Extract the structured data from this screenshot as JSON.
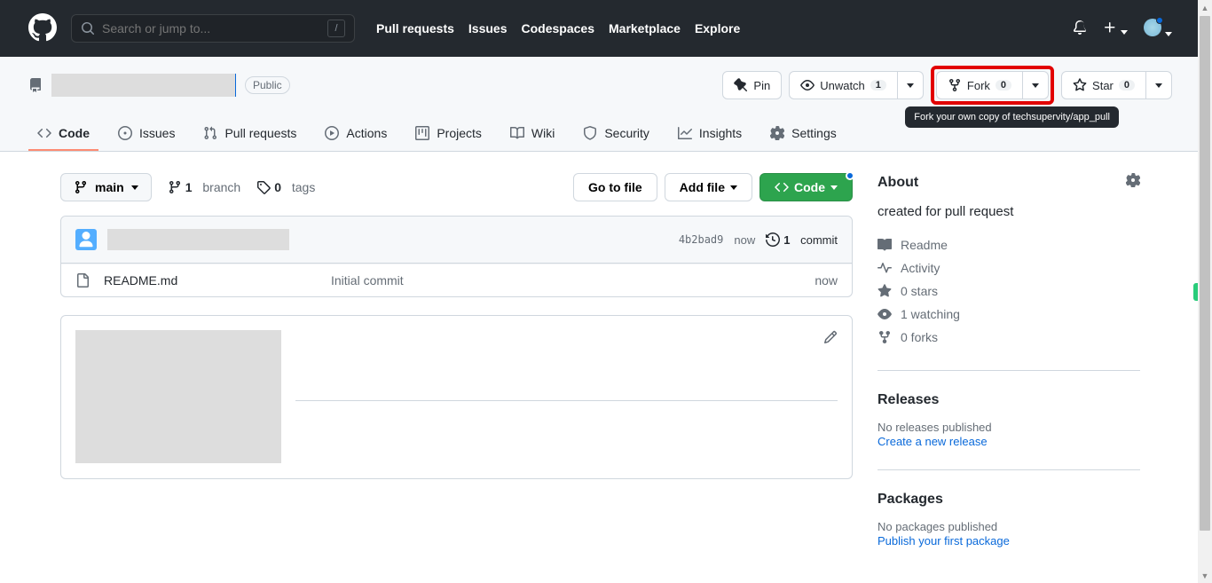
{
  "header": {
    "search_placeholder": "Search or jump to...",
    "slash": "/",
    "nav": [
      "Pull requests",
      "Issues",
      "Codespaces",
      "Marketplace",
      "Explore"
    ]
  },
  "repo": {
    "visibility": "Public",
    "actions": {
      "pin": "Pin",
      "watch": "Unwatch",
      "watch_count": "1",
      "fork": "Fork",
      "fork_count": "0",
      "star": "Star",
      "star_count": "0"
    },
    "tooltip": "Fork your own copy of techsupervity/app_pull",
    "tabs": [
      "Code",
      "Issues",
      "Pull requests",
      "Actions",
      "Projects",
      "Wiki",
      "Security",
      "Insights",
      "Settings"
    ]
  },
  "files": {
    "branch": "main",
    "branch_count": "1",
    "branch_label": "branch",
    "tag_count": "0",
    "tag_label": "tags",
    "goto": "Go to file",
    "addfile": "Add file",
    "codebtn": "Code",
    "commit_hash": "4b2bad9",
    "commit_time": "now",
    "commit_count": "1",
    "commit_label": "commit",
    "rows": [
      {
        "name": "README.md",
        "msg": "Initial commit",
        "date": "now"
      }
    ]
  },
  "sidebar": {
    "about_title": "About",
    "about_desc": "created for pull request",
    "links": {
      "readme": "Readme",
      "activity": "Activity",
      "stars": "0 stars",
      "watching": "1 watching",
      "forks": "0 forks"
    },
    "releases_title": "Releases",
    "releases_none": "No releases published",
    "releases_create": "Create a new release",
    "packages_title": "Packages",
    "packages_none": "No packages published",
    "packages_publish": "Publish your first package"
  }
}
